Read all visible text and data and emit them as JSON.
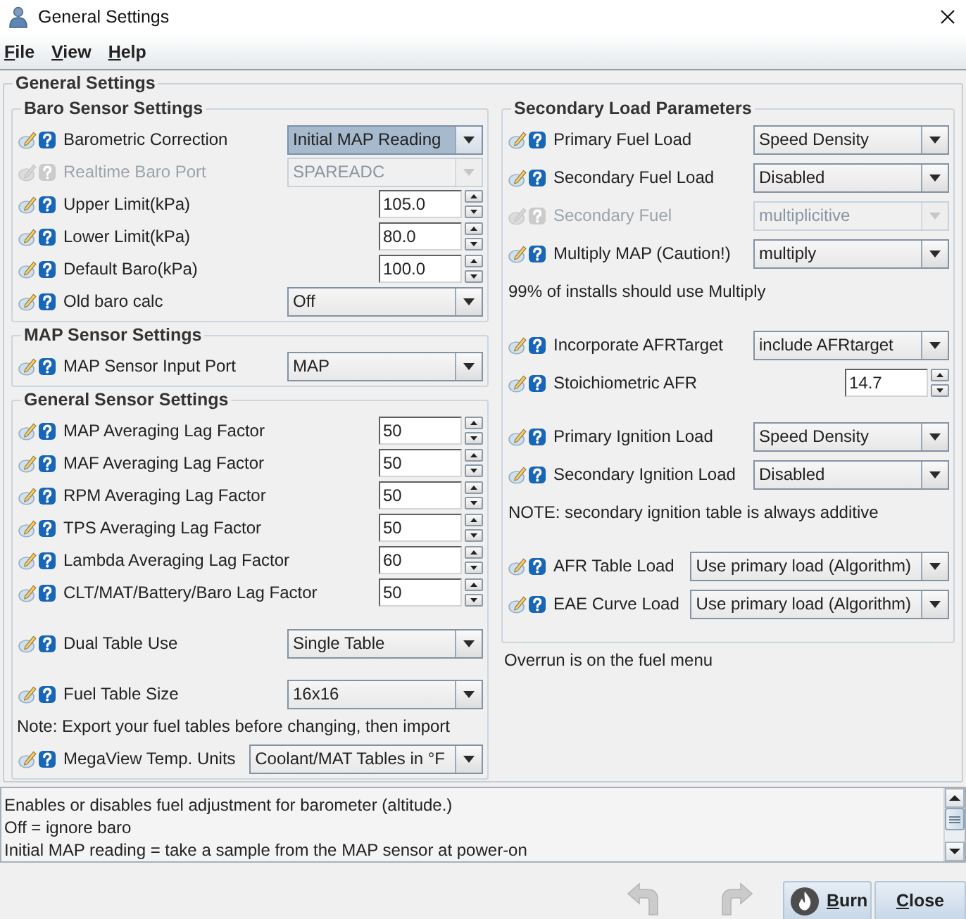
{
  "window": {
    "title": "General Settings"
  },
  "menu": [
    "File",
    "View",
    "Help"
  ],
  "panel": {
    "title": "General Settings",
    "columns": [
      {
        "groups": [
          {
            "title": "Baro Sensor Settings",
            "blocks": [
              [
                {
                  "kind": "combo",
                  "label": "Barometric Correction",
                  "value": "Initial MAP Reading",
                  "disabled": false,
                  "focused": true
                },
                {
                  "kind": "combo",
                  "label": "Realtime Baro Port",
                  "value": "SPAREADC",
                  "disabled": true,
                  "focused": false
                },
                {
                  "kind": "spinner",
                  "label": "Upper Limit(kPa)",
                  "value": "105.0",
                  "disabled": false,
                  "focused": false
                },
                {
                  "kind": "spinner",
                  "label": "Lower Limit(kPa)",
                  "value": "80.0",
                  "disabled": false,
                  "focused": false
                },
                {
                  "kind": "spinner",
                  "label": "Default Baro(kPa)",
                  "value": "100.0",
                  "disabled": false,
                  "focused": false
                },
                {
                  "kind": "combo",
                  "label": "Old baro calc",
                  "value": "Off",
                  "disabled": false,
                  "focused": false
                }
              ]
            ]
          },
          {
            "title": "MAP Sensor Settings",
            "blocks": [
              [
                {
                  "kind": "combo",
                  "label": "MAP Sensor Input Port",
                  "value": "MAP",
                  "disabled": false,
                  "focused": false
                }
              ]
            ]
          },
          {
            "title": "General Sensor Settings",
            "blocks": [
              [
                {
                  "kind": "spinner",
                  "label": "MAP Averaging Lag Factor",
                  "value": "50",
                  "disabled": false,
                  "focused": false
                },
                {
                  "kind": "spinner",
                  "label": "MAF Averaging Lag Factor",
                  "value": "50",
                  "disabled": false,
                  "focused": false
                },
                {
                  "kind": "spinner",
                  "label": "RPM Averaging Lag Factor",
                  "value": "50",
                  "disabled": false,
                  "focused": false
                },
                {
                  "kind": "spinner",
                  "label": "TPS Averaging Lag Factor",
                  "value": "50",
                  "disabled": false,
                  "focused": false
                },
                {
                  "kind": "spinner",
                  "label": "Lambda Averaging Lag Factor",
                  "value": "60",
                  "disabled": false,
                  "focused": false
                },
                {
                  "kind": "spinner",
                  "label": "CLT/MAT/Battery/Baro Lag Factor",
                  "value": "50",
                  "disabled": false,
                  "focused": false
                }
              ],
              [
                {
                  "kind": "combo",
                  "label": "Dual Table Use",
                  "value": "Single Table",
                  "disabled": false,
                  "focused": false
                }
              ],
              [
                {
                  "kind": "combo",
                  "label": "Fuel Table Size",
                  "value": "16x16",
                  "disabled": false,
                  "focused": false
                },
                {
                  "kind": "note",
                  "text": "Note: Export your fuel tables before changing, then import"
                },
                {
                  "kind": "combo",
                  "label": "MegaView Temp. Units",
                  "value": "Coolant/MAT Tables in °F",
                  "disabled": false,
                  "focused": false
                }
              ]
            ]
          }
        ]
      },
      {
        "groups": [
          {
            "title": "Secondary Load Parameters",
            "blocks": [
              [
                {
                  "kind": "combo",
                  "label": "Primary Fuel Load",
                  "value": "Speed Density",
                  "disabled": false,
                  "focused": false
                },
                {
                  "kind": "combo",
                  "label": "Secondary Fuel Load",
                  "value": "Disabled",
                  "disabled": false,
                  "focused": false
                },
                {
                  "kind": "combo",
                  "label": "Secondary Fuel",
                  "value": "multiplicitive",
                  "disabled": true,
                  "focused": false
                },
                {
                  "kind": "combo",
                  "label": "Multiply MAP (Caution!)",
                  "value": "multiply",
                  "disabled": false,
                  "focused": false
                },
                {
                  "kind": "note",
                  "text": "99% of installs should use Multiply"
                }
              ],
              [
                {
                  "kind": "combo",
                  "label": "Incorporate AFRTarget",
                  "value": "include AFRtarget",
                  "disabled": false,
                  "focused": false
                },
                {
                  "kind": "spinner",
                  "label": "Stoichiometric AFR",
                  "value": "14.7",
                  "disabled": false,
                  "focused": false
                }
              ],
              [
                {
                  "kind": "combo",
                  "label": "Primary Ignition Load",
                  "value": "Speed Density",
                  "disabled": false,
                  "focused": false
                },
                {
                  "kind": "combo",
                  "label": "Secondary Ignition Load",
                  "value": "Disabled",
                  "disabled": false,
                  "focused": false
                },
                {
                  "kind": "note",
                  "text": "NOTE: secondary ignition table is always additive"
                }
              ],
              [
                {
                  "kind": "combo",
                  "label": "AFR Table Load",
                  "value": "Use primary load (Algorithm)",
                  "disabled": false,
                  "focused": false
                },
                {
                  "kind": "combo",
                  "label": "EAE Curve Load",
                  "value": "Use primary load (Algorithm)",
                  "disabled": false,
                  "focused": false
                }
              ]
            ]
          }
        ],
        "footer": "Overrun is on the fuel menu"
      }
    ]
  },
  "help_text": "Enables or disables fuel adjustment for barometer (altitude.)\nOff = ignore baro\nInitial MAP reading = take a sample from the MAP sensor at power-on",
  "buttons": [
    {
      "kind": "undo",
      "disabled": true
    },
    {
      "kind": "redo",
      "disabled": true
    },
    {
      "kind": "burn",
      "label": "Burn",
      "disabled": false
    },
    {
      "kind": "close",
      "label": "Close",
      "disabled": false
    }
  ]
}
